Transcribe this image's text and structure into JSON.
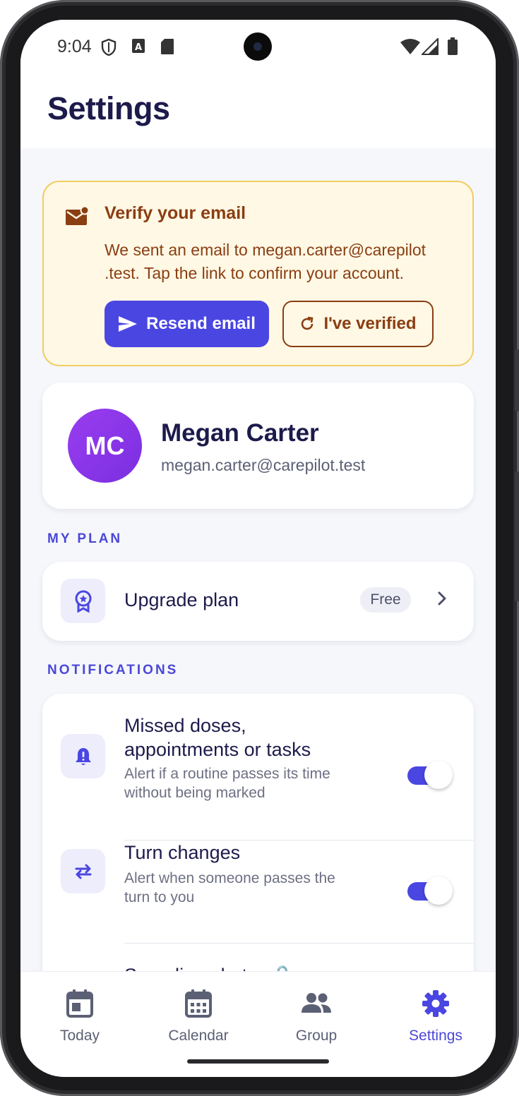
{
  "status_bar": {
    "time": "9:04",
    "icons": [
      "shield-icon",
      "a-badge-icon",
      "sd-card-icon",
      "wifi-icon",
      "signal-icon",
      "battery-icon"
    ]
  },
  "header": {
    "title": "Settings"
  },
  "verify_banner": {
    "title": "Verify your email",
    "message_line1": "We sent an email to megan.carter@carepilot",
    "message_line2": ".test. Tap the link to confirm your account.",
    "resend_label": "Resend email",
    "verified_label": "I've verified",
    "icon": "mail-alert-icon"
  },
  "profile": {
    "initials": "MC",
    "name": "Megan Carter",
    "email": "megan.carter@carepilot.test"
  },
  "plan_section": {
    "label": "MY PLAN",
    "item_label": "Upgrade plan",
    "badge": "Free",
    "icon": "award-icon"
  },
  "notifications_section": {
    "label": "NOTIFICATIONS",
    "items": [
      {
        "title_line1": "Missed doses,",
        "title_line2": "appointments or tasks",
        "desc_line1": "Alert if a routine passes its time",
        "desc_line2": "without being marked",
        "enabled": true,
        "icon": "bell-alert-icon"
      },
      {
        "title": "Turn changes",
        "desc_line1": "Alert when someone passes the",
        "desc_line2": "turn to you",
        "enabled": true,
        "icon": "swap-arrows-icon"
      },
      {
        "title": "Spending alerts",
        "title_suffix": "🔒",
        "icon": "sparkle-icon"
      }
    ]
  },
  "bottom_nav": {
    "items": [
      {
        "label": "Today",
        "icon": "calendar-today-icon",
        "active": false
      },
      {
        "label": "Calendar",
        "icon": "calendar-grid-icon",
        "active": false
      },
      {
        "label": "Group",
        "icon": "people-icon",
        "active": false
      },
      {
        "label": "Settings",
        "icon": "gear-icon",
        "active": true
      }
    ]
  },
  "colors": {
    "accent": "#4a46e2",
    "banner_bg": "#fff8e5",
    "banner_border": "#f2cd62",
    "banner_text": "#8a3e12",
    "title_text": "#1d1b4b"
  }
}
